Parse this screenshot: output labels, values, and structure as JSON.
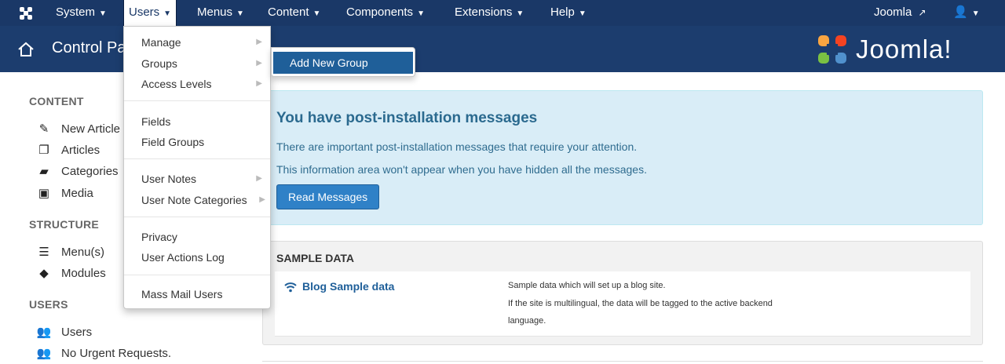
{
  "colors": {
    "navbar": "#1a3867",
    "subhead": "#1c3d6e",
    "accent": "#1f5f99",
    "alert_bg": "#d9edf7"
  },
  "navbar": {
    "brand_icon": "joomla-icon",
    "menus": [
      {
        "label": "System"
      },
      {
        "label": "Users"
      },
      {
        "label": "Menus"
      },
      {
        "label": "Content"
      },
      {
        "label": "Components"
      },
      {
        "label": "Extensions"
      },
      {
        "label": "Help"
      }
    ],
    "site_link": "Joomla",
    "site_link_icon": "external-link-icon",
    "user_icon": "user-icon"
  },
  "header": {
    "title": "Control Panel",
    "home_icon": "home-icon",
    "logo_text": "Joomla!"
  },
  "sidebar": {
    "sections": [
      {
        "heading": "CONTENT",
        "items": [
          {
            "label": "New Article",
            "icon": "pencil-icon"
          },
          {
            "label": "Articles",
            "icon": "copy-icon"
          },
          {
            "label": "Categories",
            "icon": "folder-icon"
          },
          {
            "label": "Media",
            "icon": "image-icon"
          }
        ]
      },
      {
        "heading": "STRUCTURE",
        "items": [
          {
            "label": "Menu(s)",
            "icon": "list-icon"
          },
          {
            "label": "Modules",
            "icon": "cube-icon"
          }
        ]
      },
      {
        "heading": "USERS",
        "items": [
          {
            "label": "Users",
            "icon": "users-icon"
          },
          {
            "label": "No Urgent Requests.",
            "icon": "users-icon"
          }
        ]
      }
    ]
  },
  "users_menu": {
    "items": [
      {
        "label": "Manage",
        "has_submenu": true
      },
      {
        "label": "Groups",
        "has_submenu": true
      },
      {
        "label": "Access Levels",
        "has_submenu": true
      },
      {
        "label": "Fields",
        "has_submenu": false
      },
      {
        "label": "Field Groups",
        "has_submenu": false
      },
      {
        "label": "User Notes",
        "has_submenu": true
      },
      {
        "label": "User Note Categories",
        "has_submenu": true
      },
      {
        "label": "Privacy",
        "has_submenu": false
      },
      {
        "label": "User Actions Log",
        "has_submenu": false
      },
      {
        "label": "Mass Mail Users",
        "has_submenu": false
      }
    ],
    "submenu": {
      "label": "Add New Group"
    }
  },
  "alert": {
    "title": "You have post-installation messages",
    "line1": "There are important post-installation messages that require your attention.",
    "line2": "This information area won't appear when you have hidden all the messages.",
    "button": "Read Messages"
  },
  "sample_data": {
    "heading": "SAMPLE DATA",
    "item": {
      "label": "Blog Sample data",
      "icon": "wifi-icon",
      "desc1": "Sample data which will set up a blog site.",
      "desc2": "If the site is multilingual, the data will be tagged to the active backend",
      "desc3": "language."
    }
  }
}
